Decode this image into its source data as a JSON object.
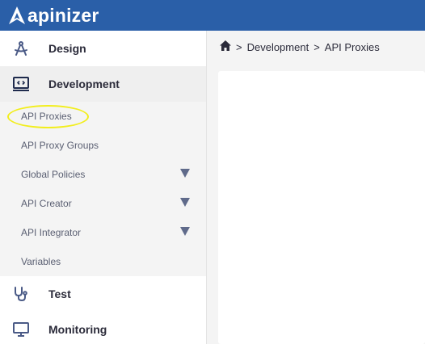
{
  "app": {
    "logo_text": "apinizer",
    "brand_color": "#2a5fa8"
  },
  "sidebar": {
    "design": {
      "label": "Design",
      "icon": "compass-icon"
    },
    "development": {
      "label": "Development",
      "icon": "code-monitor-icon"
    },
    "sub_items": [
      {
        "label": "API Proxies",
        "expandable": false
      },
      {
        "label": "API Proxy Groups",
        "expandable": false
      },
      {
        "label": "Global Policies",
        "expandable": true
      },
      {
        "label": "API Creator",
        "expandable": true
      },
      {
        "label": "API Integrator",
        "expandable": true
      },
      {
        "label": "Variables",
        "expandable": false
      }
    ],
    "test": {
      "label": "Test",
      "icon": "stethoscope-icon"
    },
    "monitoring": {
      "label": "Monitoring",
      "icon": "monitor-icon"
    }
  },
  "breadcrumb": {
    "home_icon": "home-icon",
    "separator": ">",
    "items": [
      "Development",
      "API Proxies"
    ]
  }
}
